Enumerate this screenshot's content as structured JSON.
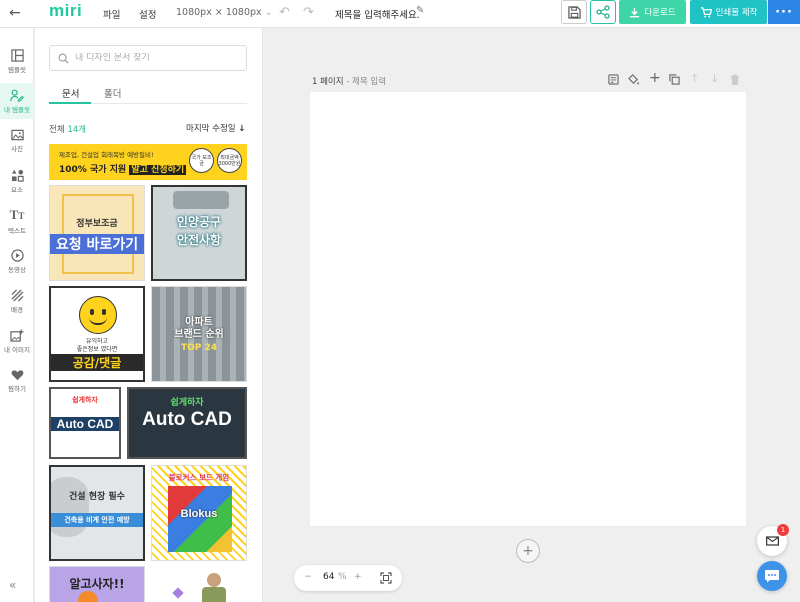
{
  "header": {
    "logo": "miri",
    "menu_file": "파일",
    "menu_settings": "설정",
    "canvas_size": "1080px × 1080px",
    "doc_title": "제목을 입력해주세요.",
    "download_label": "다운로드",
    "print_label": "인쇄물 제작"
  },
  "rail": [
    {
      "label": "템플릿",
      "icon": "layout-icon"
    },
    {
      "label": "내 템플릿",
      "icon": "user-edit-icon"
    },
    {
      "label": "사진",
      "icon": "photo-icon"
    },
    {
      "label": "요소",
      "icon": "shapes-icon"
    },
    {
      "label": "텍스트",
      "icon": "text-icon"
    },
    {
      "label": "동영상",
      "icon": "play-icon"
    },
    {
      "label": "배경",
      "icon": "pattern-icon"
    },
    {
      "label": "내 이미지",
      "icon": "image-add-icon"
    },
    {
      "label": "찜하기",
      "icon": "heart-icon"
    }
  ],
  "panel": {
    "search_placeholder": "내 디자인 문서 찾기",
    "tab_docs": "문서",
    "tab_folders": "폴더",
    "count_prefix": "전체",
    "count_value": "14개",
    "sort_label": "마지막 수정일",
    "banner": {
      "line1": "제조업, 건설업 회래복방 예방필비!",
      "line2": "100% 국가 지원",
      "line2_highlight": "알고 신청하기",
      "badge1": "국가\n보조금",
      "badge2": "최대금액\n3000만원"
    },
    "thumbs": [
      {
        "main": "요청 바로가기",
        "top": "정부보조금"
      },
      {
        "main": "안전사항",
        "top": "인양공구"
      },
      {
        "main": "공감/댓글",
        "top": "유익하고",
        "mid": "좋은정보 였다면"
      },
      {
        "main": "브랜드 순위",
        "top": "아파트",
        "tag": "TOP 24"
      },
      {
        "main": "Auto CAD",
        "top": "쉽게하자"
      },
      {
        "main": "Auto CAD",
        "top": "쉽게하자"
      },
      {
        "main": "건설 현장 필수",
        "sub": "건축용 비계 안전 예방"
      },
      {
        "main": "Blokus",
        "top": "블로커스 보드 게임"
      },
      {
        "main": "알고사자!!"
      }
    ]
  },
  "canvas": {
    "page_label": "1 페이지",
    "page_sub": "- 제목 입력",
    "zoom_value": "64",
    "zoom_unit": "%",
    "notif_count": "1"
  }
}
